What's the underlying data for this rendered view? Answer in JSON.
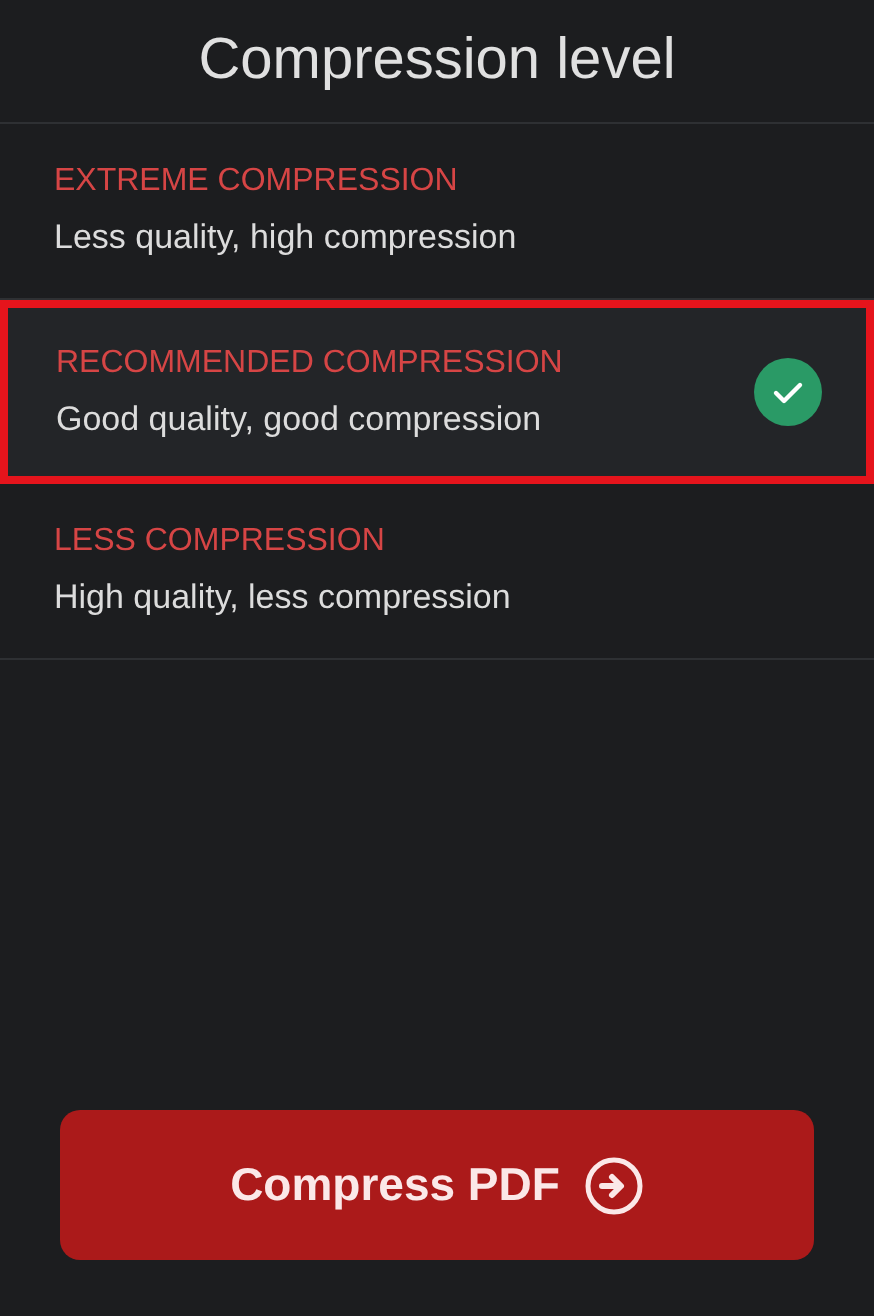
{
  "title": "Compression level",
  "options": [
    {
      "label": "EXTREME COMPRESSION",
      "description": "Less quality, high compression",
      "selected": false
    },
    {
      "label": "RECOMMENDED COMPRESSION",
      "description": "Good quality, good compression",
      "selected": true
    },
    {
      "label": "LESS COMPRESSION",
      "description": "High quality, less compression",
      "selected": false
    }
  ],
  "button": {
    "label": "Compress PDF"
  }
}
